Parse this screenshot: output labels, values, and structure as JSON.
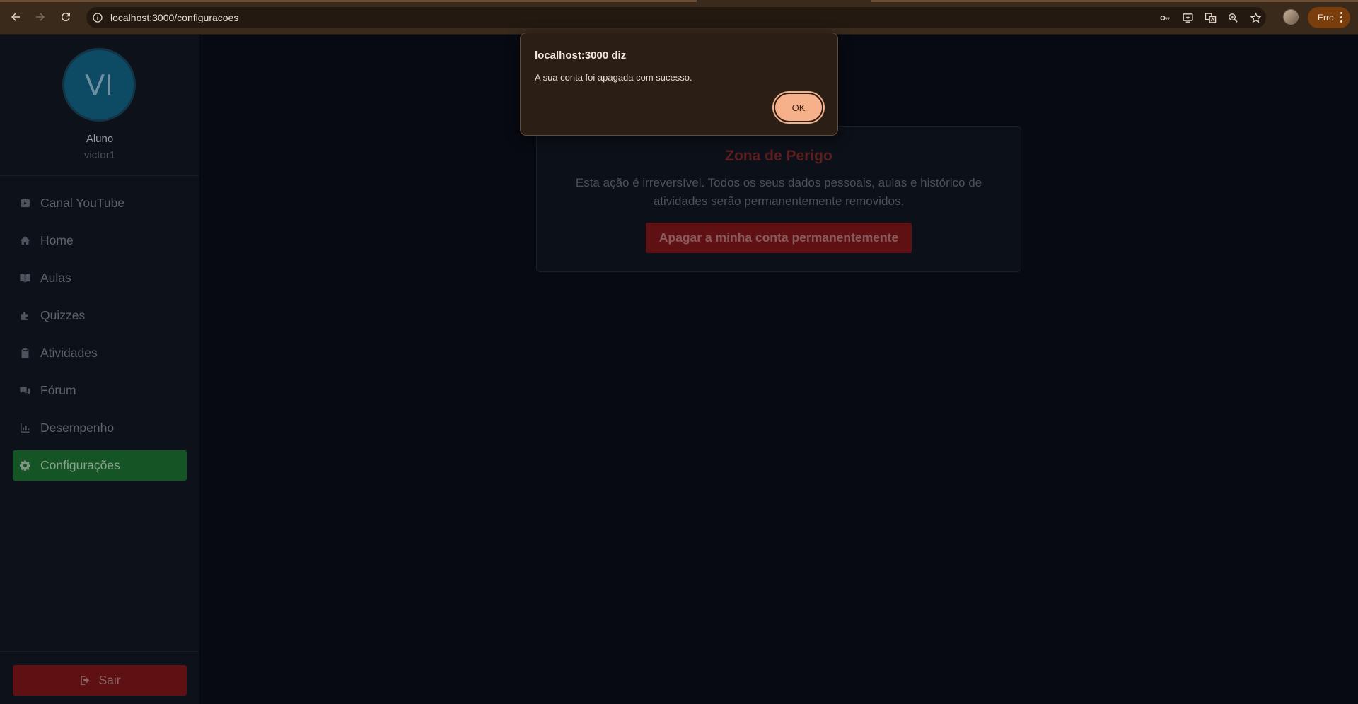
{
  "browser": {
    "url": "localhost:3000/configuracoes",
    "profile_status": "Erro"
  },
  "sidebar": {
    "avatar_initials": "VI",
    "role": "Aluno",
    "username": "victor1",
    "items": [
      {
        "label": "Canal YouTube",
        "icon": "youtube-icon"
      },
      {
        "label": "Home",
        "icon": "home-icon"
      },
      {
        "label": "Aulas",
        "icon": "book-icon"
      },
      {
        "label": "Quizzes",
        "icon": "puzzle-icon"
      },
      {
        "label": "Atividades",
        "icon": "clipboard-check-icon"
      },
      {
        "label": "Fórum",
        "icon": "comments-icon"
      },
      {
        "label": "Desempenho",
        "icon": "bar-chart-icon"
      },
      {
        "label": "Configurações",
        "icon": "gear-icon",
        "active": true
      }
    ],
    "logout_label": "Sair"
  },
  "danger_zone": {
    "title": "Zona de Perigo",
    "description": "Esta ação é irreversível. Todos os seus dados pessoais, aulas e histórico de atividades serão permanentemente removidos.",
    "button_label": "Apagar a minha conta permanentemente"
  },
  "alert": {
    "title": "localhost:3000 diz",
    "message": "A sua conta foi apagada com sucesso.",
    "ok_label": "OK"
  },
  "colors": {
    "accent_active": "#155424",
    "danger": "#5f1013",
    "dialog_button": "#f6b08a"
  }
}
